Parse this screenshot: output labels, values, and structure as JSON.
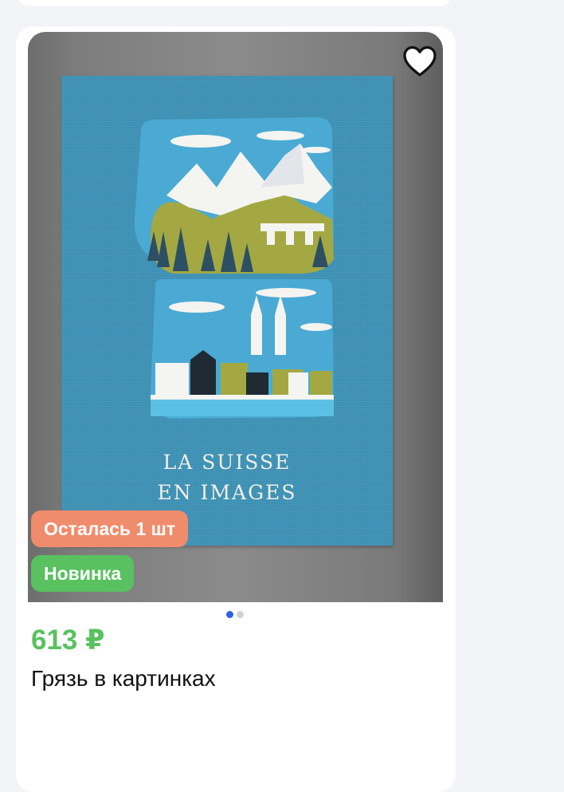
{
  "product": {
    "cover_line1": "LA SUISSE",
    "cover_line2": "EN IMAGES",
    "badge_stock": "Осталась 1 шт",
    "badge_new": "Новинка",
    "price": "613 ₽",
    "title": "Грязь в картинках",
    "favorite_icon": "heart-icon",
    "gallery": {
      "count": 2,
      "active": 1
    }
  },
  "colors": {
    "price": "#59c160",
    "badge_stock": "#ef8c6b",
    "badge_new": "#59c160",
    "dot_active": "#2f62e0",
    "dot_inactive": "#cfd1d6"
  }
}
